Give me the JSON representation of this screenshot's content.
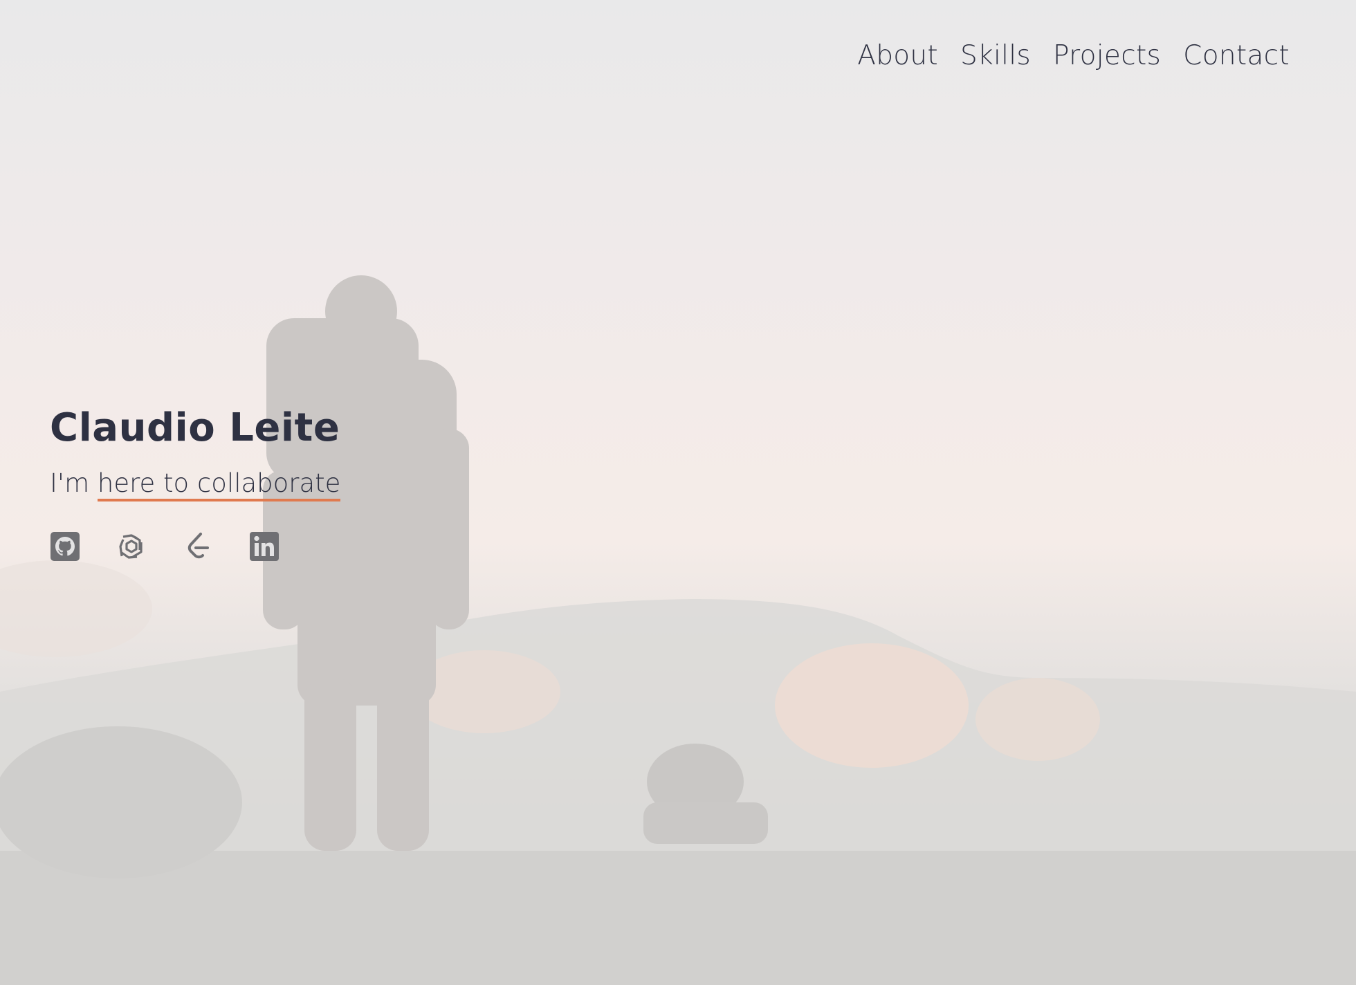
{
  "nav": {
    "items": [
      {
        "label": "About"
      },
      {
        "label": "Skills"
      },
      {
        "label": "Projects"
      },
      {
        "label": "Contact"
      }
    ]
  },
  "hero": {
    "name": "Claudio Leite",
    "tagline_prefix": "I'm",
    "tagline_highlight": "here to collaborate"
  },
  "socials": [
    {
      "icon": "github-icon"
    },
    {
      "icon": "openai-icon"
    },
    {
      "icon": "leetcode-icon"
    },
    {
      "icon": "linkedin-icon"
    }
  ],
  "colors": {
    "text": "#2e3142",
    "accent_underline": "#e07a4f",
    "icon": "#6f6f73"
  }
}
